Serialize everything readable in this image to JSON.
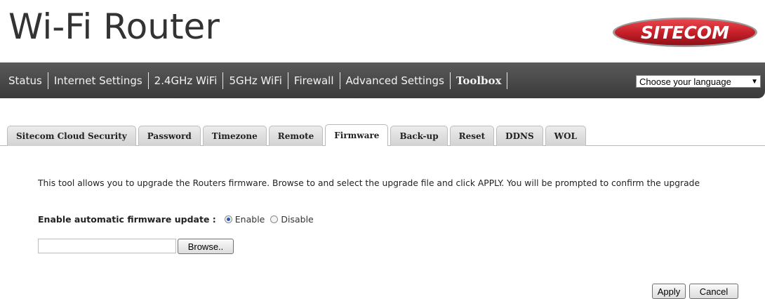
{
  "header": {
    "title": "Wi-Fi Router",
    "brand": "SITECOM",
    "brand_color": "#c8202a"
  },
  "nav": {
    "items": [
      {
        "label": "Status",
        "active": false
      },
      {
        "label": "Internet Settings",
        "active": false
      },
      {
        "label": "2.4GHz WiFi",
        "active": false
      },
      {
        "label": "5GHz WiFi",
        "active": false
      },
      {
        "label": "Firewall",
        "active": false
      },
      {
        "label": "Advanced Settings",
        "active": false
      },
      {
        "label": "Toolbox",
        "active": true
      }
    ],
    "language_select": "Choose your language"
  },
  "tabs": [
    {
      "label": "Sitecom Cloud Security",
      "active": false
    },
    {
      "label": "Password",
      "active": false
    },
    {
      "label": "Timezone",
      "active": false
    },
    {
      "label": "Remote",
      "active": false
    },
    {
      "label": "Firmware",
      "active": true
    },
    {
      "label": "Back-up",
      "active": false
    },
    {
      "label": "Reset",
      "active": false
    },
    {
      "label": "DDNS",
      "active": false
    },
    {
      "label": "WOL",
      "active": false
    }
  ],
  "firmware": {
    "description": "This tool allows you to upgrade the Routers firmware. Browse to and select the upgrade file and click APPLY. You will be prompted to confirm the upgrade",
    "auto_update_label": "Enable automatic firmware update :",
    "enable_label": "Enable",
    "disable_label": "Disable",
    "auto_update_value": "Enable",
    "file_value": "",
    "browse_label": "Browse..",
    "apply_label": "Apply",
    "cancel_label": "Cancel"
  }
}
